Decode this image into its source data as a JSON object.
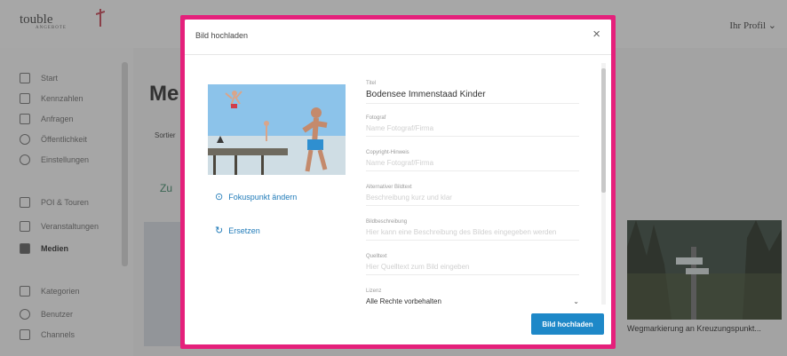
{
  "app": {
    "logo_text": "touble",
    "logo_sub": "ANGEBOTE",
    "user_menu": "Ihr Profil ⌄"
  },
  "sidebar": {
    "items": [
      {
        "label": "Start",
        "icon": "home-icon"
      },
      {
        "label": "Kennzahlen",
        "icon": "chart-icon"
      },
      {
        "label": "Anfragen",
        "icon": "inbox-icon"
      },
      {
        "label": "Öffentlichkeit",
        "icon": "globe-icon"
      },
      {
        "label": "Einstellungen",
        "icon": "heart-icon"
      },
      {
        "label": "POI & Touren",
        "icon": "grid-icon"
      },
      {
        "label": "Veranstaltungen",
        "icon": "calendar-icon"
      },
      {
        "label": "Medien",
        "icon": "images-icon"
      },
      {
        "label": "Kategorien",
        "icon": "hierarchy-icon"
      },
      {
        "label": "Benutzer",
        "icon": "user-icon"
      },
      {
        "label": "Channels",
        "icon": "list-icon"
      }
    ]
  },
  "background": {
    "page_title": "Me",
    "small_text": "Sortier",
    "link_text": "Zu",
    "caption": "Wegmarkierung an Kreuzungspunkt..."
  },
  "modal": {
    "title": "Bild hochladen",
    "close": "×",
    "actions": {
      "focus": "Fokuspunkt ändern",
      "replace": "Ersetzen"
    },
    "fields": [
      {
        "label": "Titel",
        "value": "Bodensee Immenstaad Kinder",
        "placeholder": ""
      },
      {
        "label": "Fotograf",
        "value": "",
        "placeholder": "Name Fotograf/Firma"
      },
      {
        "label": "Copyright-Hinweis",
        "value": "",
        "placeholder": "Name Fotograf/Firma"
      },
      {
        "label": "Alternativer Bildtext",
        "value": "",
        "placeholder": "Beschreibung kurz und klar"
      },
      {
        "label": "Bildbeschreibung",
        "value": "",
        "placeholder": "Hier kann eine Beschreibung des Bildes eingegeben werden"
      },
      {
        "label": "Quelltext",
        "value": "",
        "placeholder": "Hier Quelltext zum Bild eingeben"
      },
      {
        "label": "Lizenz",
        "value": "Alle Rechte vorbehalten",
        "placeholder": ""
      }
    ],
    "submit": "Bild hochladen"
  },
  "colors": {
    "highlight": "#e5207b",
    "primary": "#1e88c8",
    "link": "#1f7ab8"
  }
}
